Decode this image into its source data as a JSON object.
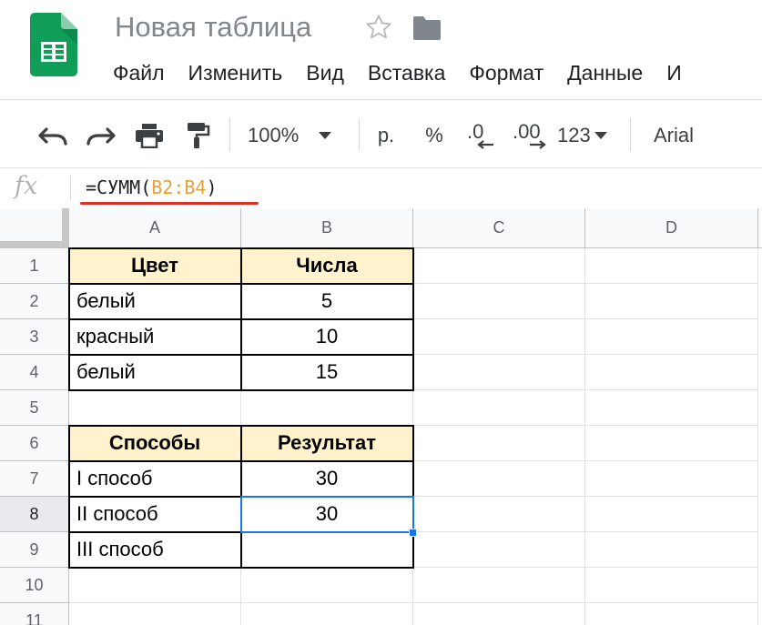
{
  "app": {
    "document_title": "Новая таблица",
    "logo_icon": "google-sheets-logo",
    "star_icon": "star-outline-icon",
    "folder_icon": "folder-icon",
    "accent_color": "#1a73e8",
    "header_fill": "#fff2cc"
  },
  "menu": {
    "items": [
      {
        "label": "Файл"
      },
      {
        "label": "Изменить"
      },
      {
        "label": "Вид"
      },
      {
        "label": "Вставка"
      },
      {
        "label": "Формат"
      },
      {
        "label": "Данные"
      },
      {
        "label": "И"
      }
    ]
  },
  "toolbar": {
    "zoom": "100%",
    "currency": "р.",
    "percent": "%",
    "decrease_decimals": ".0",
    "increase_decimals": ".00",
    "more_formats": "123",
    "font": "Arial"
  },
  "formula_bar": {
    "fx_label": "fx",
    "prefix": "=СУММ(",
    "range_ref": "B2:B4",
    "suffix": ")"
  },
  "grid": {
    "columns": [
      "A",
      "B",
      "C",
      "D"
    ],
    "rows": [
      "1",
      "2",
      "3",
      "4",
      "5",
      "6",
      "7",
      "8",
      "9",
      "10",
      "11"
    ],
    "selected_cell": "B8",
    "cells": {
      "A1": "Цвет",
      "B1": "Числа",
      "A2": "белый",
      "B2": "5",
      "A3": "красный",
      "B3": "10",
      "A4": "белый",
      "B4": "15",
      "A6": "Способы",
      "B6": "Результат",
      "A7": "I способ",
      "B7": "30",
      "A8": "II способ",
      "B8": "30",
      "A9": "III способ",
      "B9": ""
    }
  }
}
